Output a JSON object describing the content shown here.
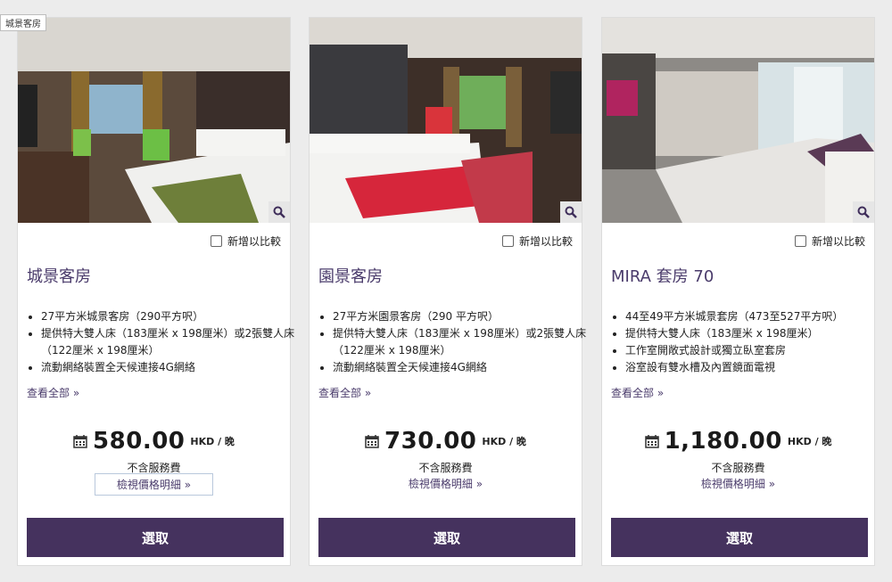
{
  "tooltip": "城景客房",
  "compare_label": "新增以比較",
  "view_all_label": "查看全部 »",
  "currency_unit": "HKD / 晚",
  "service_note": "不含服務費",
  "price_detail_label": "檢視價格明細 »",
  "select_label": "選取",
  "rooms": [
    {
      "name": "城景客房",
      "features": [
        "27平方米城景客房（290平方呎）",
        "提供特大雙人床（183厘米 x 198厘米）或2張雙人床（122厘米 x 198厘米）",
        "流動網絡裝置全天候連接4G網絡"
      ],
      "price": "580.00"
    },
    {
      "name": "園景客房",
      "features": [
        "27平方米園景客房（290 平方呎）",
        "提供特大雙人床（183厘米 x 198厘米）或2張雙人床（122厘米 x 198厘米）",
        "流動網絡裝置全天候連接4G網絡"
      ],
      "price": "730.00"
    },
    {
      "name": "MIRA 套房 70",
      "features": [
        "44至49平方米城景套房（473至527平方呎）",
        "提供特大雙人床（183厘米 x 198厘米）",
        "工作室開敞式設計或獨立臥室套房",
        "浴室設有雙水槽及內置鏡面電視"
      ],
      "price": "1,180.00"
    }
  ]
}
